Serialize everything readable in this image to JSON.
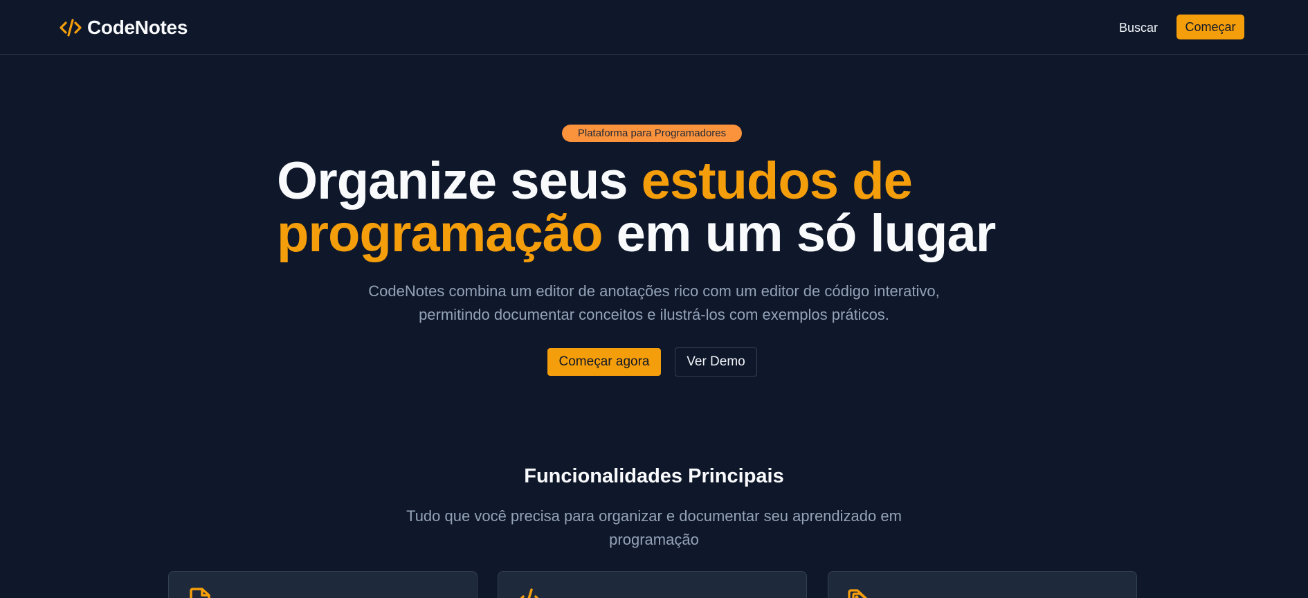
{
  "header": {
    "brand": "CodeNotes",
    "nav_search": "Buscar",
    "nav_start": "Começar"
  },
  "hero": {
    "badge": "Plataforma para Programadores",
    "title_part1": "Organize seus ",
    "title_highlight1": "estudos de",
    "title_highlight2": "programação",
    "title_part2": " em um só lugar",
    "subtitle": "CodeNotes combina um editor de anotações rico com um editor de código interativo, permitindo documentar conceitos e ilustrá-los com exemplos práticos.",
    "primary_button": "Começar agora",
    "secondary_button": "Ver Demo"
  },
  "features": {
    "title": "Funcionalidades Principais",
    "subtitle": "Tudo que você precisa para organizar e documentar seu aprendizado em programação",
    "cards": [
      {
        "icon": "file-icon"
      },
      {
        "icon": "code-icon"
      },
      {
        "icon": "tags-icon"
      }
    ]
  },
  "colors": {
    "background": "#0f172a",
    "accent": "#f59e0b",
    "badge": "#fb923c",
    "muted_text": "#94a3b8",
    "card": "#1e293b"
  }
}
